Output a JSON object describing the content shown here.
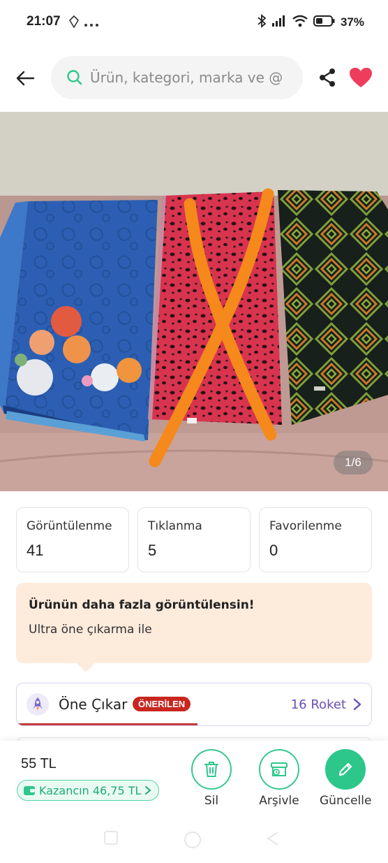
{
  "status_bar": {
    "time": "21:07",
    "battery": "37%"
  },
  "header": {
    "search_placeholder": "Ürün, kategori, marka ve @"
  },
  "gallery": {
    "counter": "1/6"
  },
  "stats": [
    {
      "label": "Görüntülenme",
      "value": "41"
    },
    {
      "label": "Tıklanma",
      "value": "5"
    },
    {
      "label": "Favorilenme",
      "value": "0"
    }
  ],
  "promo": {
    "title": "Ürünün daha fazla görüntülensin!",
    "subtitle": "Ultra öne çıkarma ile"
  },
  "boost": {
    "label": "Öne Çıkar",
    "badge": "ÖNERİLEN",
    "rockets": "16 Roket",
    "progress": 0.51
  },
  "bottom": {
    "price": "55 TL",
    "earnings": "Kazancın 46,75 TL",
    "actions": {
      "delete": "Sil",
      "archive": "Arşivle",
      "update": "Güncelle"
    }
  },
  "colors": {
    "accent_green": "#2ec78b",
    "heart_red": "#ee3d5c",
    "badge_red": "#c8261f",
    "rocket_purple": "#6a4fb6",
    "promo_bg": "#fdebdc"
  }
}
